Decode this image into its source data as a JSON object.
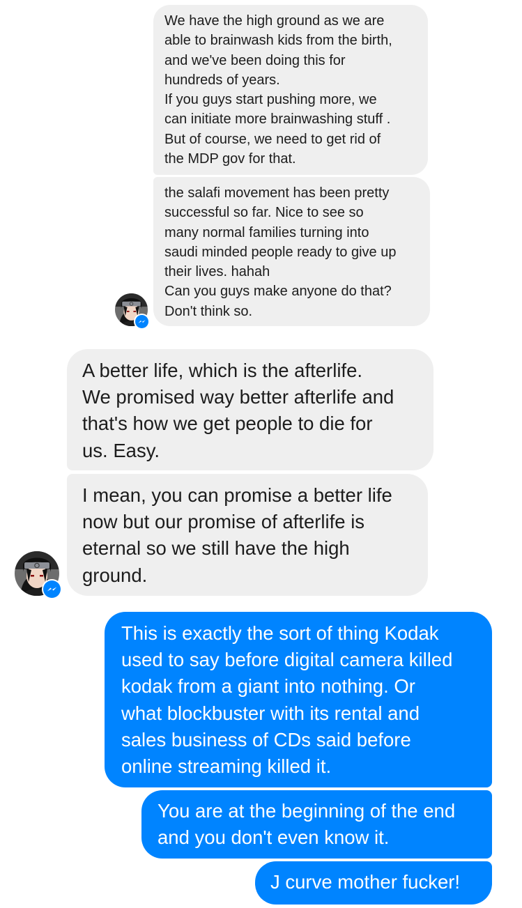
{
  "conversation": {
    "messages": [
      {
        "sender": "contact",
        "text": "We have the high ground as we are\nable to brainwash kids from the birth,\nand we've been doing this for\nhundreds of years.\nIf you guys start pushing more, we\ncan initiate more brainwashing stuff .\nBut of course, we need to get rid of\nthe MDP gov for that."
      },
      {
        "sender": "contact",
        "text": "the salafi movement has been pretty\nsuccessful so far. Nice to see so\nmany normal families turning into\nsaudi minded people ready to give up\ntheir lives. hahah\nCan you guys make anyone do that?\nDon't think so."
      },
      {
        "sender": "contact",
        "text": "A better life, which is the afterlife.\nWe promised way better afterlife and\nthat's how we get people to die for\nus. Easy."
      },
      {
        "sender": "contact",
        "text": "I mean, you can promise a better life\nnow but our promise of afterlife is\neternal so we still have the high\nground."
      },
      {
        "sender": "me",
        "text": "This is exactly the sort of thing Kodak\nused to say before digital camera killed\nkodak from a giant into nothing. Or\nwhat blockbuster with its rental and\nsales business of CDs said before\nonline streaming killed it."
      },
      {
        "sender": "me",
        "text": "You are at the beginning of the end\nand you don't even know it."
      },
      {
        "sender": "me",
        "text": "J curve mother fucker!"
      }
    ]
  },
  "colors": {
    "incoming_bubble": "#efefef",
    "outgoing_bubble": "#0084ff",
    "messenger_badge": "#0084ff"
  },
  "icons": {
    "avatar": "contact-avatar",
    "badge": "messenger-icon"
  }
}
